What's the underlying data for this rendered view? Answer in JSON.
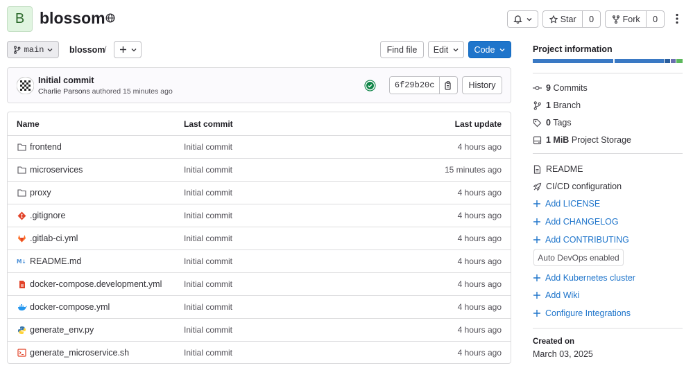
{
  "project": {
    "avatar_letter": "B",
    "name": "blossom"
  },
  "header": {
    "star_label": "Star",
    "star_count": "0",
    "fork_label": "Fork",
    "fork_count": "0"
  },
  "toolbar": {
    "branch": "main",
    "breadcrumb": "blossom",
    "breadcrumb_sep": "/",
    "find_file": "Find file",
    "edit": "Edit",
    "code": "Code"
  },
  "commit": {
    "title": "Initial commit",
    "author": "Charlie Parsons",
    "authored_text": "authored 15 minutes ago",
    "sha": "6f29b20c",
    "history_label": "History"
  },
  "table": {
    "headers": {
      "name": "Name",
      "last_commit": "Last commit",
      "last_update": "Last update"
    },
    "rows": [
      {
        "name": "frontend",
        "commit": "Initial commit",
        "updated": "4 hours ago",
        "icon": "folder-icon"
      },
      {
        "name": "microservices",
        "commit": "Initial commit",
        "updated": "15 minutes ago",
        "icon": "folder-icon"
      },
      {
        "name": "proxy",
        "commit": "Initial commit",
        "updated": "4 hours ago",
        "icon": "folder-icon"
      },
      {
        "name": ".gitignore",
        "commit": "Initial commit",
        "updated": "4 hours ago",
        "icon": "git-icon"
      },
      {
        "name": ".gitlab-ci.yml",
        "commit": "Initial commit",
        "updated": "4 hours ago",
        "icon": "gitlab-icon"
      },
      {
        "name": "README.md",
        "commit": "Initial commit",
        "updated": "4 hours ago",
        "icon": "markdown-icon"
      },
      {
        "name": "docker-compose.development.yml",
        "commit": "Initial commit",
        "updated": "4 hours ago",
        "icon": "file-red-icon"
      },
      {
        "name": "docker-compose.yml",
        "commit": "Initial commit",
        "updated": "4 hours ago",
        "icon": "docker-icon"
      },
      {
        "name": "generate_env.py",
        "commit": "Initial commit",
        "updated": "4 hours ago",
        "icon": "python-icon"
      },
      {
        "name": "generate_microservice.sh",
        "commit": "Initial commit",
        "updated": "4 hours ago",
        "icon": "shell-icon"
      }
    ]
  },
  "sidebar": {
    "title": "Project information",
    "stats": [
      {
        "value": "9",
        "label": "Commits"
      },
      {
        "value": "1",
        "label": "Branch"
      },
      {
        "value": "0",
        "label": "Tags"
      },
      {
        "value": "1 MiB",
        "label": "Project Storage"
      }
    ],
    "links": [
      {
        "label": "README"
      },
      {
        "label": "CI/CD configuration"
      },
      {
        "label": "Add LICENSE"
      },
      {
        "label": "Add CHANGELOG"
      },
      {
        "label": "Add CONTRIBUTING"
      }
    ],
    "auto_devops": "Auto DevOps enabled",
    "links2": [
      {
        "label": "Add Kubernetes cluster"
      },
      {
        "label": "Add Wiki"
      },
      {
        "label": "Configure Integrations"
      }
    ],
    "created_label": "Created on",
    "created_date": "March 03, 2025",
    "language_colors": [
      "#3a79c4",
      "#3a79c4",
      "#2b5f9e",
      "#6a6fae",
      "#5cb85c"
    ]
  }
}
